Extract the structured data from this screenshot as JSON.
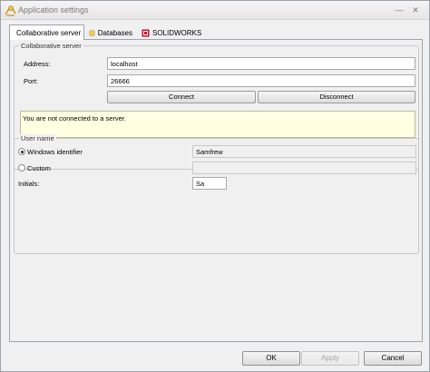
{
  "window": {
    "title": "Application settings"
  },
  "tabs": [
    {
      "label": "Collaborative server",
      "icon": "server-icon"
    },
    {
      "label": "Databases",
      "icon": "database-icon"
    },
    {
      "label": "SOLIDWORKS",
      "icon": "solidworks-icon"
    }
  ],
  "server": {
    "group_label": "Collaborative server",
    "address_label": "Address:",
    "address_value": "localhost",
    "port_label": "Port:",
    "port_value": "26666",
    "connect_label": "Connect",
    "disconnect_label": "Disconnect",
    "status_text": "You are not connected to a server."
  },
  "user": {
    "group_label": "User name",
    "windows_label": "Windows identifier",
    "windows_value": "Samfrew",
    "custom_label": "Custom",
    "custom_value": "",
    "initials_label": "Initials:",
    "initials_value": "Sa"
  },
  "footer": {
    "ok_label": "OK",
    "apply_label": "Apply",
    "cancel_label": "Cancel"
  },
  "colors": {
    "status_bg": "#ffffe1",
    "window_bg": "#f0f0f0",
    "solidworks_red": "#c8102e"
  }
}
